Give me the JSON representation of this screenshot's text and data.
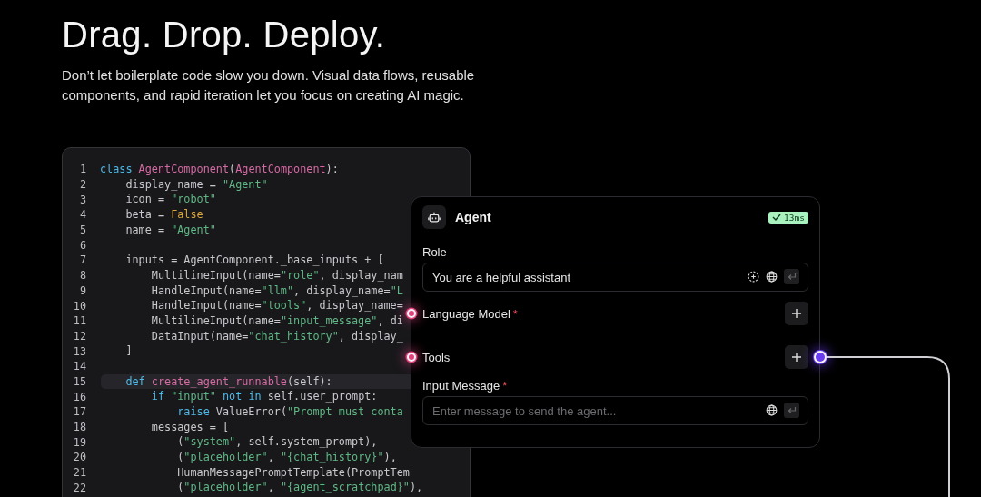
{
  "heading": "Drag. Drop. Deploy.",
  "description": "Don’t let boilerplate code slow you down. Visual data flows, reusable components, and rapid iteration let you focus on creating AI magic.",
  "code": {
    "lines": [
      {
        "number": "1",
        "highlighted": false,
        "tokens": [
          {
            "text": "class",
            "kind": "keyword"
          },
          {
            "text": " AgentComponent",
            "kind": "name"
          },
          {
            "text": "(",
            "kind": "plain"
          },
          {
            "text": "AgentComponent",
            "kind": "name"
          },
          {
            "text": "):",
            "kind": "plain"
          }
        ]
      },
      {
        "number": "2",
        "highlighted": false,
        "tokens": [
          {
            "text": "    display_name = ",
            "kind": "plain"
          },
          {
            "text": "\"Agent\"",
            "kind": "string"
          }
        ]
      },
      {
        "number": "3",
        "highlighted": false,
        "tokens": [
          {
            "text": "    icon = ",
            "kind": "plain"
          },
          {
            "text": "\"robot\"",
            "kind": "string"
          }
        ]
      },
      {
        "number": "4",
        "highlighted": false,
        "tokens": [
          {
            "text": "    beta = ",
            "kind": "plain"
          },
          {
            "text": "False",
            "kind": "constant"
          }
        ]
      },
      {
        "number": "5",
        "highlighted": false,
        "tokens": [
          {
            "text": "    name = ",
            "kind": "plain"
          },
          {
            "text": "\"Agent\"",
            "kind": "string"
          }
        ]
      },
      {
        "number": "6",
        "highlighted": false
      },
      {
        "number": "7",
        "highlighted": false,
        "tokens": [
          {
            "text": "    inputs = AgentComponent._base_inputs + [",
            "kind": "plain"
          }
        ]
      },
      {
        "number": "8",
        "highlighted": false,
        "tokens": [
          {
            "text": "        MultilineInput(name=",
            "kind": "plain"
          },
          {
            "text": "\"role\"",
            "kind": "string"
          },
          {
            "text": ", display_nam",
            "kind": "plain"
          }
        ]
      },
      {
        "number": "9",
        "highlighted": false,
        "tokens": [
          {
            "text": "        HandleInput(name=",
            "kind": "plain"
          },
          {
            "text": "\"llm\"",
            "kind": "string"
          },
          {
            "text": ", display_name=",
            "kind": "plain"
          },
          {
            "text": "\"L",
            "kind": "string"
          }
        ]
      },
      {
        "number": "10",
        "highlighted": false,
        "tokens": [
          {
            "text": "        HandleInput(name=",
            "kind": "plain"
          },
          {
            "text": "\"tools\"",
            "kind": "string"
          },
          {
            "text": ", display_name=",
            "kind": "plain"
          }
        ]
      },
      {
        "number": "11",
        "highlighted": false,
        "tokens": [
          {
            "text": "        MultilineInput(name=",
            "kind": "plain"
          },
          {
            "text": "\"input_message\"",
            "kind": "string"
          },
          {
            "text": ", di",
            "kind": "plain"
          }
        ]
      },
      {
        "number": "12",
        "highlighted": false,
        "tokens": [
          {
            "text": "        DataInput(name=",
            "kind": "plain"
          },
          {
            "text": "\"chat_history\"",
            "kind": "string"
          },
          {
            "text": ", display_",
            "kind": "plain"
          }
        ]
      },
      {
        "number": "13",
        "highlighted": false,
        "tokens": [
          {
            "text": "    ]",
            "kind": "plain"
          }
        ]
      },
      {
        "number": "14",
        "highlighted": false
      },
      {
        "number": "15",
        "highlighted": true,
        "tokens": [
          {
            "text": "    def",
            "kind": "keyword"
          },
          {
            "text": " create_agent_runnable",
            "kind": "name"
          },
          {
            "text": "(self):",
            "kind": "plain"
          }
        ]
      },
      {
        "number": "16",
        "highlighted": false,
        "tokens": [
          {
            "text": "        if",
            "kind": "keyword"
          },
          {
            "text": " \"input\"",
            "kind": "string"
          },
          {
            "text": " not",
            "kind": "keyword"
          },
          {
            "text": " in",
            "kind": "keyword"
          },
          {
            "text": " self.user_prompt:",
            "kind": "plain"
          }
        ]
      },
      {
        "number": "17",
        "highlighted": false,
        "tokens": [
          {
            "text": "            raise",
            "kind": "keyword"
          },
          {
            "text": " ValueError(",
            "kind": "plain"
          },
          {
            "text": "\"Prompt must conta",
            "kind": "string"
          }
        ]
      },
      {
        "number": "18",
        "highlighted": false,
        "tokens": [
          {
            "text": "        messages = [",
            "kind": "plain"
          }
        ]
      },
      {
        "number": "19",
        "highlighted": false,
        "tokens": [
          {
            "text": "            (",
            "kind": "plain"
          },
          {
            "text": "\"system\"",
            "kind": "string"
          },
          {
            "text": ", self.system_prompt),",
            "kind": "plain"
          }
        ]
      },
      {
        "number": "20",
        "highlighted": false,
        "tokens": [
          {
            "text": "            (",
            "kind": "plain"
          },
          {
            "text": "\"placeholder\"",
            "kind": "string"
          },
          {
            "text": ", ",
            "kind": "plain"
          },
          {
            "text": "\"{chat_history}\"",
            "kind": "string"
          },
          {
            "text": "),",
            "kind": "plain"
          }
        ]
      },
      {
        "number": "21",
        "highlighted": false,
        "tokens": [
          {
            "text": "            HumanMessagePromptTemplate(PromptTem",
            "kind": "plain"
          }
        ]
      },
      {
        "number": "22",
        "highlighted": false,
        "tokens": [
          {
            "text": "            (",
            "kind": "plain"
          },
          {
            "text": "\"placeholder\"",
            "kind": "string"
          },
          {
            "text": ", ",
            "kind": "plain"
          },
          {
            "text": "\"{agent_scratchpad}\"",
            "kind": "string"
          },
          {
            "text": "),",
            "kind": "plain"
          }
        ]
      }
    ]
  },
  "node": {
    "title": "Agent",
    "badge": "13ms",
    "fields": [
      {
        "kind": "text",
        "label": "Role",
        "value": "You are a helpful assistant",
        "variable_button": true
      },
      {
        "kind": "handle",
        "label": "Language Model",
        "required_mark": "*",
        "output_handle": false
      },
      {
        "kind": "handle",
        "label": "Tools",
        "output_handle": true
      },
      {
        "kind": "text",
        "label": "Input Message",
        "required_mark": "*",
        "placeholder": "Enter message to send the agent...",
        "variable_button": false
      }
    ]
  }
}
